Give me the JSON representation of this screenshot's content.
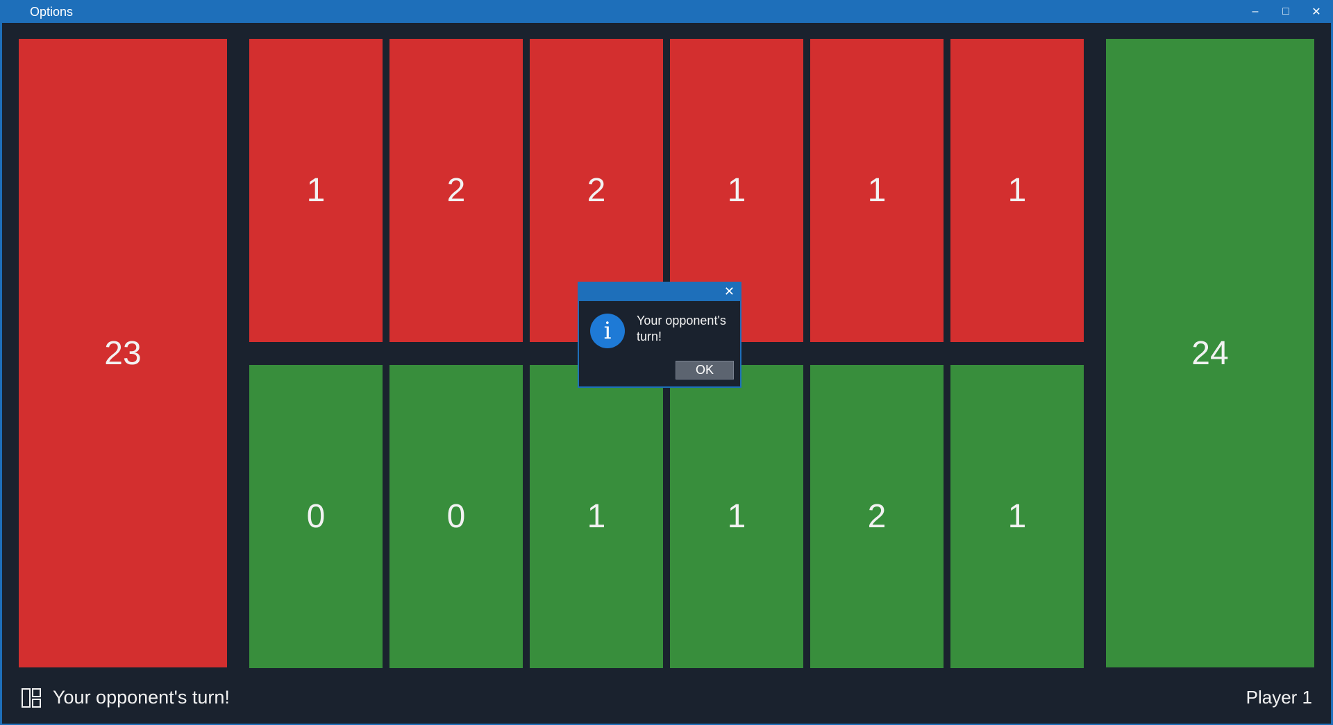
{
  "window": {
    "title": "Options",
    "minimize": "–",
    "maximize": "□",
    "close": "✕"
  },
  "board": {
    "opponent_store": "23",
    "player_store": "24",
    "opponent_pits": [
      "1",
      "2",
      "2",
      "1",
      "1",
      "1"
    ],
    "player_pits": [
      "0",
      "0",
      "1",
      "1",
      "2",
      "1"
    ]
  },
  "status": {
    "message": "Your opponent's turn!",
    "player": "Player 1"
  },
  "dialog": {
    "message": "Your opponent's turn!",
    "ok_label": "OK",
    "close": "✕"
  },
  "colors": {
    "opponent": "#d32f2f",
    "player": "#388e3c",
    "accent": "#1e6fba",
    "background": "#1a222e"
  }
}
